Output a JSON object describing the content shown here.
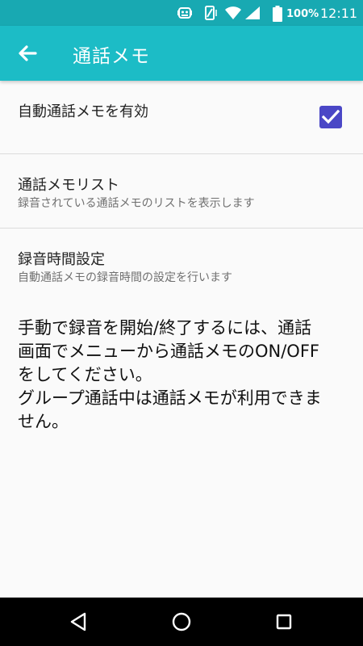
{
  "status_bar": {
    "battery_percent": "100%",
    "time": "12:11",
    "icons": [
      "notification-icon",
      "vibrate-icon",
      "wifi-icon",
      "signal-icon",
      "battery-icon"
    ]
  },
  "app_bar": {
    "title": "通話メモ",
    "back_icon": "arrow-left-icon"
  },
  "settings": {
    "auto_memo": {
      "title": "自動通話メモを有効",
      "checked": true
    },
    "memo_list": {
      "title": "通話メモリスト",
      "summary": "録音されている通話メモのリストを表示します"
    },
    "record_time": {
      "title": "録音時間設定",
      "summary": "自動通話メモの録音時間の設定を行います"
    }
  },
  "info": {
    "line1": "手動で録音を開始/終了するには、通話",
    "line2": "画面でメニューから通話メモのON/OFF",
    "line3": "をしてください。",
    "line4": "グループ通話中は通話メモが利用できま",
    "line5": "せん。"
  },
  "nav": {
    "back_icon": "triangle-back-icon",
    "home_icon": "circle-home-icon",
    "recent_icon": "square-recent-icon"
  },
  "colors": {
    "status_bar": "#18a9b2",
    "app_bar": "#1cbcc6",
    "checkbox": "#4a47c6"
  }
}
